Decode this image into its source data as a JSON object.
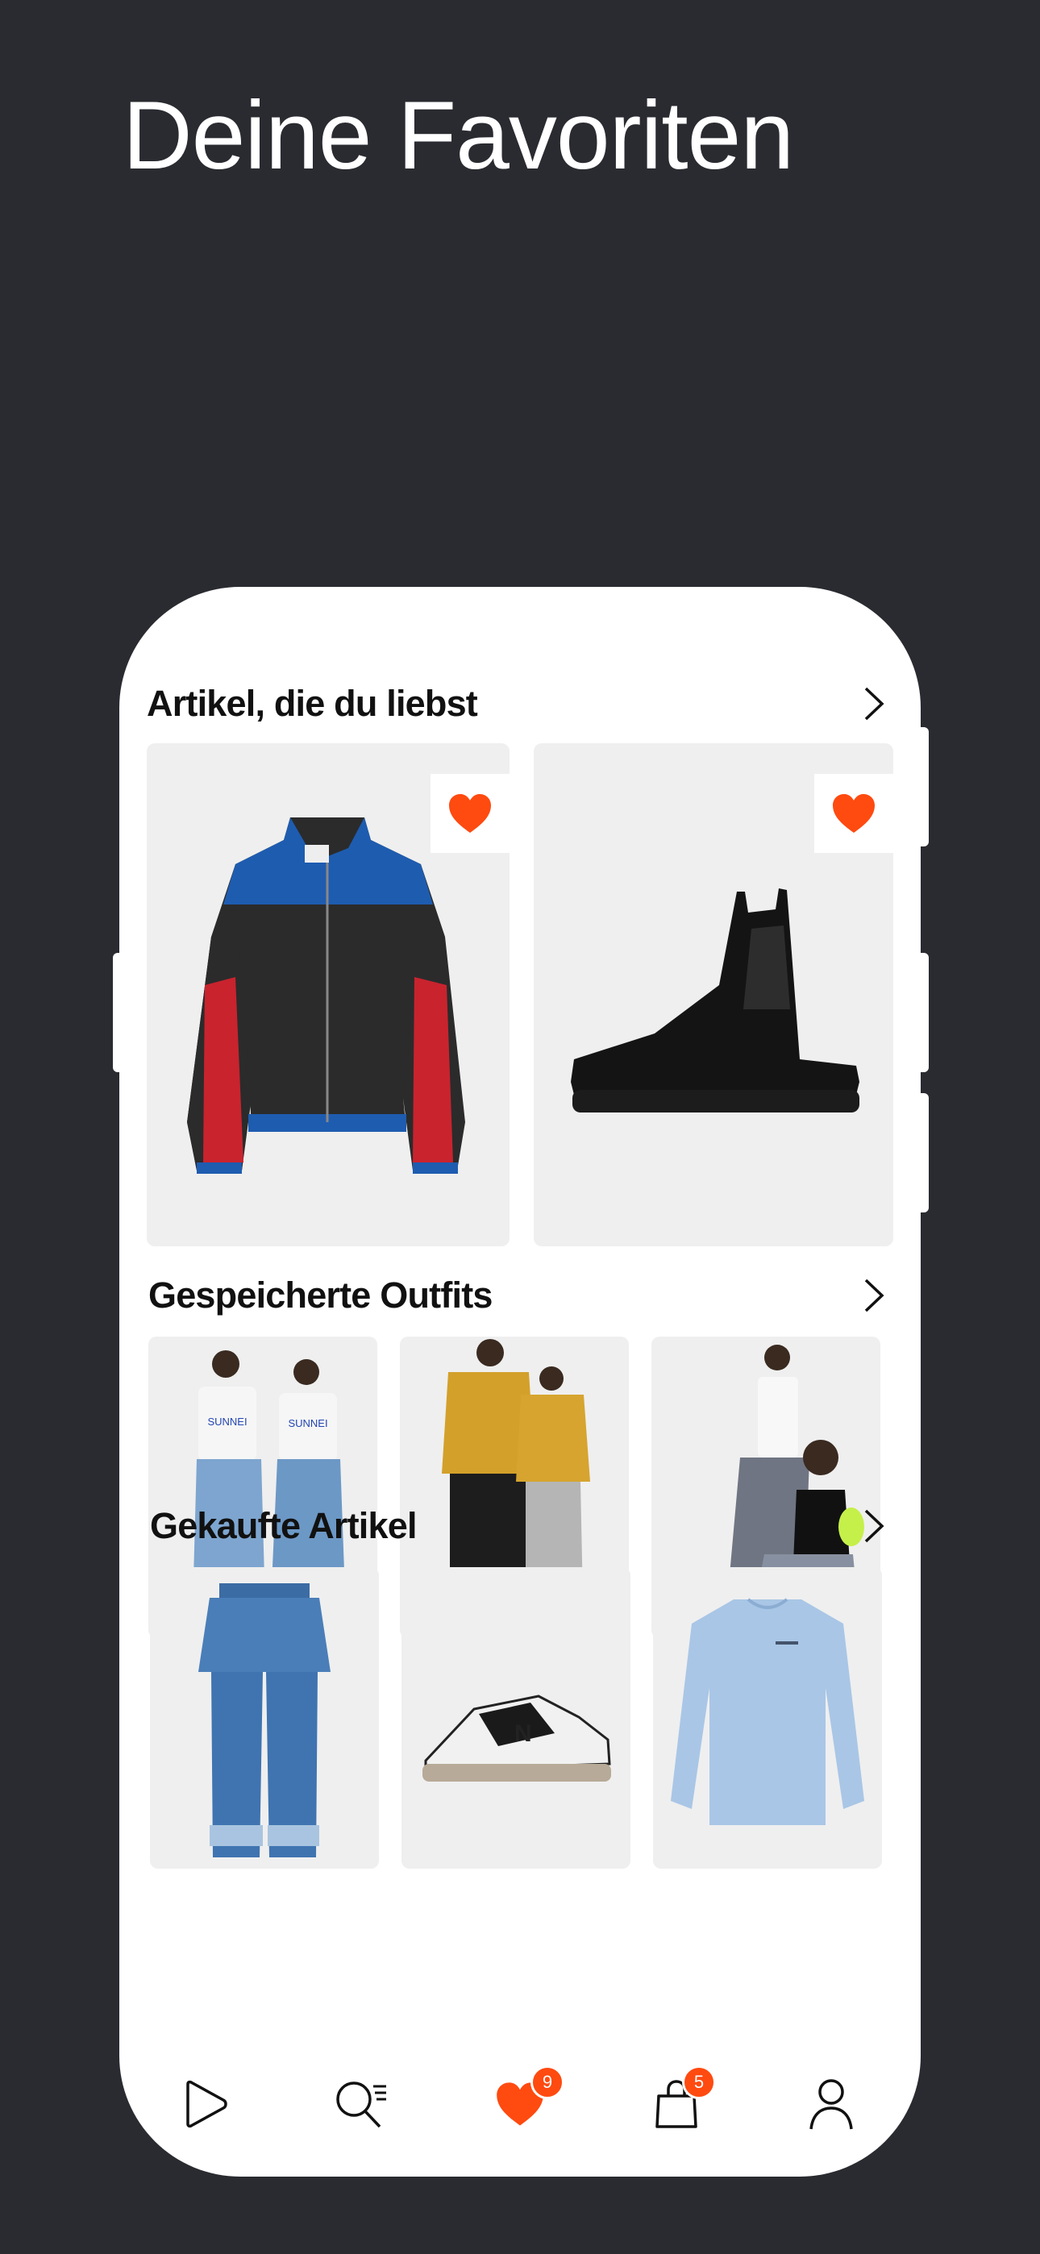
{
  "headline": "Deine Favoriten",
  "colors": {
    "background": "#2a2b30",
    "accent": "#ff4a10",
    "tile": "#efefef"
  },
  "sections": {
    "favorites": {
      "title": "Artikel, die du liebst",
      "items": [
        {
          "name": "leather-bomber-jacket",
          "favorited": true
        },
        {
          "name": "black-chelsea-boot",
          "favorited": true
        }
      ]
    },
    "outfits": {
      "title": "Gespeicherte Outfits",
      "items": [
        {
          "name": "outfit-white-tees-wide-jeans"
        },
        {
          "name": "outfit-yellow-jackets"
        },
        {
          "name": "outfit-grey-trousers"
        }
      ]
    },
    "purchased": {
      "title": "Gekaufte Artikel",
      "items": [
        {
          "name": "frayed-wide-jeans"
        },
        {
          "name": "new-balance-sneaker"
        },
        {
          "name": "light-blue-sweatshirt"
        }
      ]
    }
  },
  "tabbar": {
    "items": [
      {
        "icon": "home-play-icon"
      },
      {
        "icon": "search-list-icon"
      },
      {
        "icon": "heart-icon",
        "badge": "9",
        "active": true
      },
      {
        "icon": "bag-icon",
        "badge": "5"
      },
      {
        "icon": "profile-icon"
      }
    ]
  }
}
